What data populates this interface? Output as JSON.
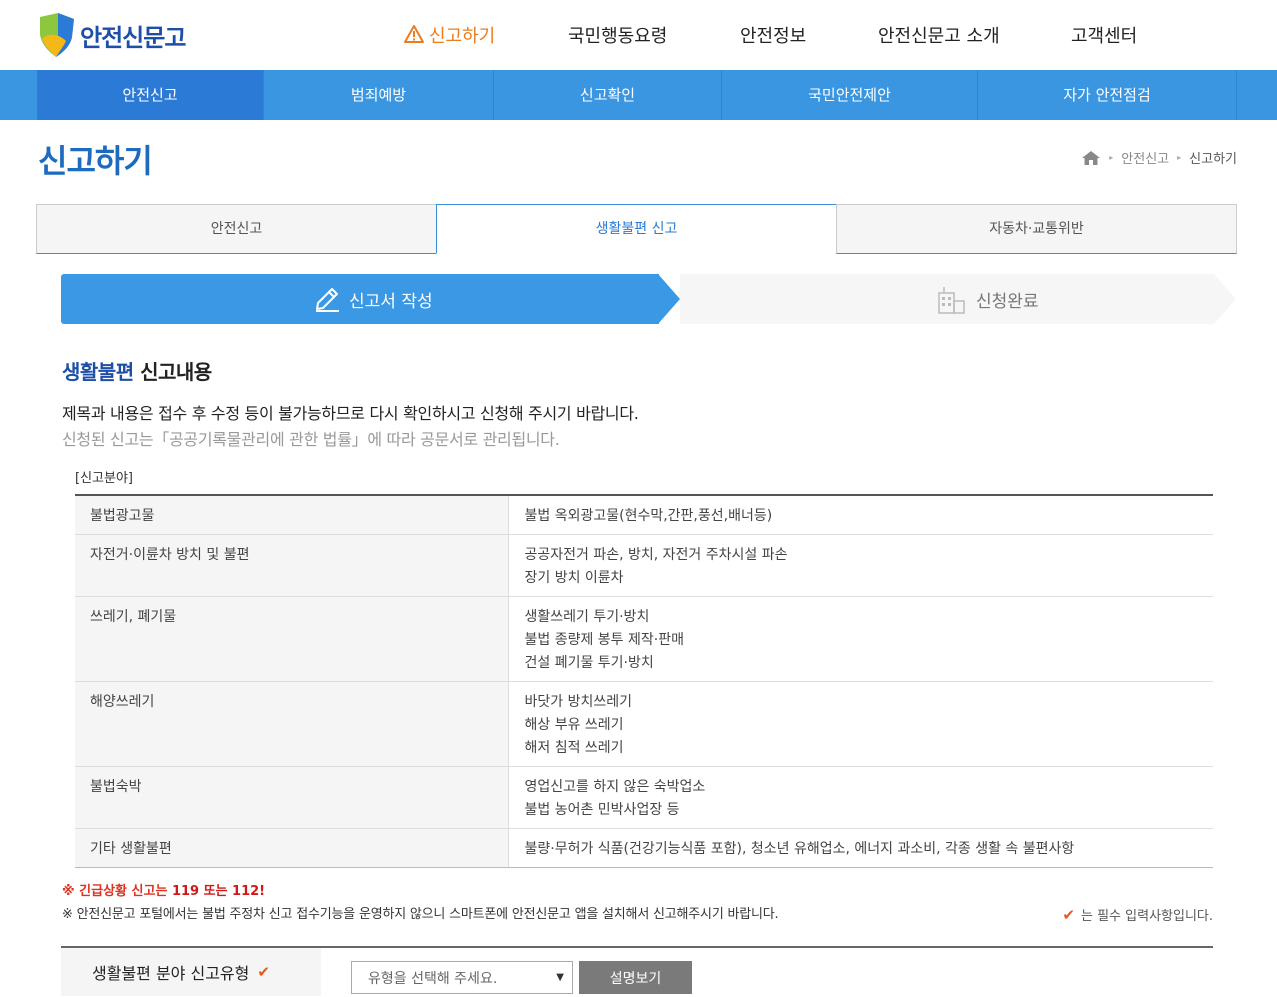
{
  "brand": {
    "name": "안전신문고"
  },
  "gnb": [
    {
      "label": "신고하기",
      "active": true
    },
    {
      "label": "국민행동요령"
    },
    {
      "label": "안전정보"
    },
    {
      "label": "안전신문고 소개"
    },
    {
      "label": "고객센터"
    }
  ],
  "subnav": [
    {
      "label": "안전신고",
      "active": true
    },
    {
      "label": "범죄예방"
    },
    {
      "label": "신고확인"
    },
    {
      "label": "국민안전제안"
    },
    {
      "label": "자가 안전점검"
    }
  ],
  "page": {
    "title": "신고하기",
    "breadcrumb": [
      "안전신고",
      "신고하기"
    ]
  },
  "tabs": [
    {
      "label": "안전신고"
    },
    {
      "label": "생활불편 신고",
      "active": true
    },
    {
      "label": "자동차·교통위반"
    }
  ],
  "steps": [
    {
      "label": "신고서 작성",
      "active": true
    },
    {
      "label": "신청완료"
    }
  ],
  "section": {
    "title_highlight": "생활불편",
    "title_rest": " 신고내용",
    "notice1": "제목과 내용은 접수 후 수정 등이 불가능하므로 다시 확인하시고 신청해 주시기 바랍니다.",
    "notice2": "신청된 신고는「공공기록물관리에 관한 법률」에 따라 공문서로 관리됩니다.",
    "field_caption": "[신고분야]"
  },
  "categories": [
    {
      "name": "불법광고물",
      "items": [
        "불법 옥외광고물(현수막,간판,풍선,배너등)"
      ]
    },
    {
      "name": "자전거·이륜차 방치 및 불편",
      "items": [
        "공공자전거 파손, 방치, 자전거 주차시설 파손",
        "장기 방치 이륜차"
      ]
    },
    {
      "name": "쓰레기, 폐기물",
      "items": [
        "생활쓰레기 투기·방치",
        "불법 종량제 봉투 제작·판매",
        "건설 폐기물 투기·방치"
      ]
    },
    {
      "name": "해양쓰레기",
      "items": [
        "바닷가 방치쓰레기",
        "해상 부유 쓰레기",
        "해저 침적 쓰레기"
      ]
    },
    {
      "name": "불법숙박",
      "items": [
        "영업신고를 하지 않은 숙박업소",
        "불법 농어촌 민박사업장 등"
      ]
    },
    {
      "name": "기타 생활불편",
      "items": [
        "불량·무허가 식품(건강기능식품 포함), 청소년 유해업소, 에너지 과소비, 각종 생활 속 불편사항"
      ]
    }
  ],
  "warnings": {
    "emergency_prefix": "※ 긴급상황 신고는 ",
    "emergency_numbers": "119 또는 112!",
    "info": "※ 안전신문고 포털에서는 불법 주정차 신고 접수기능을 운영하지 않으니 스마트폰에 안전신문고 앱을 설치해서 신고해주시기 바랍니다.",
    "required": "는 필수 입력사항입니다."
  },
  "form": {
    "type_label": "생활불편 분야 신고유형",
    "select_placeholder": "유형을 선택해 주세요.",
    "desc_button": "설명보기"
  },
  "colors": {
    "primary": "#3a96e0",
    "active_tab": "#2a7ad6",
    "accent_orange": "#ee7c1d",
    "emergency_red": "#e03020"
  },
  "icons": {
    "logo": "shield-logo-icon",
    "warning": "warning-triangle-icon",
    "home": "home-icon",
    "pencil": "pencil-icon",
    "building": "building-icon",
    "check": "check-icon"
  }
}
